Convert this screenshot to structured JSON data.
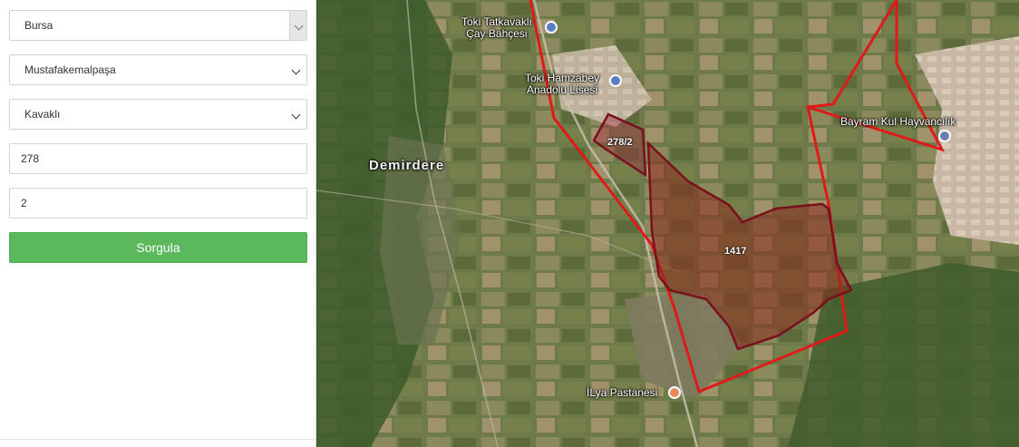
{
  "form": {
    "province": "Bursa",
    "district": "Mustafakemalpaşa",
    "neighborhood": "Kavaklı",
    "block": "278",
    "parcel": "2",
    "submit_label": "Sorgula"
  },
  "map": {
    "places": {
      "demirdere": "Demirdere",
      "tatkavakli": "Toki Tatkavaklı\nÇay Bahçesi",
      "hamzabey": "Toki Hamzabey\nAnadolu Lisesi",
      "bayram": "Bayram Kul Hayvancılık",
      "ilya": "İLya Pastanesi"
    },
    "parcels": {
      "selected": "278/2",
      "neighbor": "1417"
    },
    "colors": {
      "boundary": "#e0191a",
      "parcel_outline": "#7a0f1e",
      "button": "#5cb85c"
    },
    "icons": [
      "school-icon",
      "cafe-icon",
      "business-icon",
      "bakery-icon"
    ]
  }
}
